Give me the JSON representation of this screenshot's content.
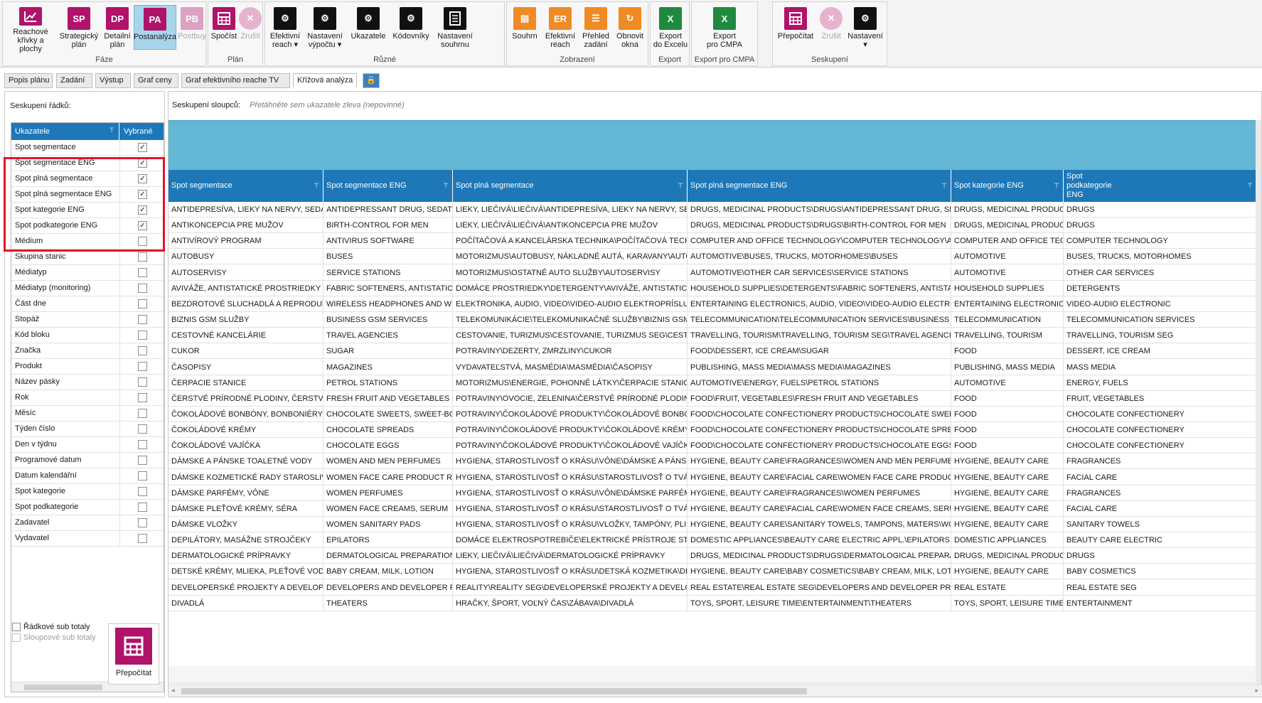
{
  "ribbon": {
    "groups": [
      {
        "title": "Fáze",
        "buttons": [
          {
            "label": "Reachové\nkřivky a plochy",
            "icon": "chart-icon",
            "abbr": "",
            "color": "#b0136a"
          },
          {
            "label": "Strategický\nplán",
            "icon": "sp-icon",
            "abbr": "SP",
            "color": "#b0136a"
          },
          {
            "label": "Detailní\nplán",
            "icon": "dp-icon",
            "abbr": "DP",
            "color": "#b0136a"
          },
          {
            "label": "Postanalýza",
            "icon": "pa-icon",
            "abbr": "PA",
            "color": "#b0136a",
            "active": true
          },
          {
            "label": "Postbuy",
            "icon": "pb-icon",
            "abbr": "PB",
            "color": "#d9a3c5",
            "disabled": true
          }
        ]
      },
      {
        "title": "Plán",
        "buttons": [
          {
            "label": "Spočíst",
            "icon": "calculator-icon",
            "color": "#b0136a"
          },
          {
            "label": "Zrušit",
            "icon": "cancel-icon",
            "color": "#e0a6c4",
            "disabled": true
          }
        ]
      },
      {
        "title": "Různé",
        "buttons": [
          {
            "label": "Efektivní\nreach ▾",
            "icon": "gear-icon",
            "color": "#111111"
          },
          {
            "label": "Nastavení\nvýpočtu ▾",
            "icon": "gear-icon",
            "color": "#111111"
          },
          {
            "label": "Ukazatele",
            "icon": "gear-icon",
            "color": "#111111"
          },
          {
            "label": "Kódovníky",
            "icon": "gear-icon",
            "color": "#111111"
          },
          {
            "label": "Nastavení\nsouhrnu",
            "icon": "document-icon",
            "color": "#111111"
          }
        ]
      },
      {
        "title": "Zobrazení",
        "buttons": [
          {
            "label": "Souhrn",
            "icon": "clipboard-icon",
            "color": "#f08a24"
          },
          {
            "label": "Efektivní\nreach",
            "icon": "er-icon",
            "abbr": "ER",
            "color": "#f08a24"
          },
          {
            "label": "Přehled\nzadání",
            "icon": "list-icon",
            "color": "#f08a24"
          },
          {
            "label": "Obnovit\nokna",
            "icon": "refresh-icon",
            "color": "#f08a24"
          }
        ]
      },
      {
        "title": "Export",
        "buttons": [
          {
            "label": "Export\ndo Excelu",
            "icon": "excel-icon",
            "abbr": "X",
            "color": "#1f8a3f"
          }
        ]
      },
      {
        "title": "Export pro CMPA",
        "buttons": [
          {
            "label": "Export\npro CMPA",
            "icon": "excel-icon",
            "abbr": "X",
            "color": "#1f8a3f"
          }
        ]
      },
      {
        "title": "Seskupení",
        "buttons": [
          {
            "label": "Přepočítat",
            "icon": "calculator-icon",
            "color": "#b0136a"
          },
          {
            "label": "Zrušit",
            "icon": "cancel-icon",
            "color": "#e0a6c4",
            "disabled": true
          },
          {
            "label": "Nastavení\n▾",
            "icon": "gear-icon",
            "color": "#111111"
          }
        ]
      }
    ]
  },
  "tabs": [
    "Popis plánu",
    "Zadání",
    "Výstup",
    "Graf ceny",
    "Graf efektivního reache TV",
    "Křížová analýza"
  ],
  "left": {
    "title": "Seskupení řádků:",
    "col1": "Ukazatele",
    "col2": "Vybrané",
    "rows": [
      {
        "label": "Spot segmentace",
        "checked": true
      },
      {
        "label": "Spot segmentace ENG",
        "checked": true
      },
      {
        "label": "Spot plná segmentace",
        "checked": true
      },
      {
        "label": "Spot plná segmentace ENG",
        "checked": true
      },
      {
        "label": "Spot kategorie ENG",
        "checked": true
      },
      {
        "label": "Spot podkategorie ENG",
        "checked": true
      },
      {
        "label": "Médium",
        "checked": false
      },
      {
        "label": "Skupina stanic",
        "checked": false
      },
      {
        "label": "Médiatyp",
        "checked": false
      },
      {
        "label": "Médiatyp (monitoring)",
        "checked": false
      },
      {
        "label": "Část dne",
        "checked": false
      },
      {
        "label": "Stopáž",
        "checked": false
      },
      {
        "label": "Kód bloku",
        "checked": false
      },
      {
        "label": "Značka",
        "checked": false
      },
      {
        "label": "Produkt",
        "checked": false
      },
      {
        "label": "Název pásky",
        "checked": false
      },
      {
        "label": "Rok",
        "checked": false
      },
      {
        "label": "Měsíc",
        "checked": false
      },
      {
        "label": "Týden číslo",
        "checked": false
      },
      {
        "label": "Den v týdnu",
        "checked": false
      },
      {
        "label": "Programové datum",
        "checked": false
      },
      {
        "label": "Datum kalendářní",
        "checked": false
      },
      {
        "label": "Spot kategorie",
        "checked": false
      },
      {
        "label": "Spot podkategorie",
        "checked": false
      },
      {
        "label": "Zadavatel",
        "checked": false
      },
      {
        "label": "Vydavatel",
        "checked": false
      }
    ],
    "row_subtotals": "Řádkové sub totaly",
    "col_subtotals": "Sloupcové sub totaly",
    "recalc": "Přepočítat"
  },
  "main": {
    "colgroup_label": "Seskupení sloupců:",
    "colgroup_placeholder": "Přetáhněte sem ukazatele zleva (nepovinné)",
    "headers": [
      "Spot segmentace",
      "Spot segmentace ENG",
      "Spot plná segmentace",
      "Spot plná segmentace ENG",
      "Spot kategorie ENG",
      "Spot\npodkategorie\nENG"
    ],
    "rows": [
      [
        "ANTIDEPRESÍVA, LIEKY NA NERVY, SEDATÍVA",
        "ANTIDEPRESSANT DRUG, SEDATIVES",
        "LIEKY, LIEČIVÁ\\LIEČIVÁ\\ANTIDEPRESÍVA, LIEKY NA NERVY, SEDATÍVA",
        "DRUGS, MEDICINAL PRODUCTS\\DRUGS\\ANTIDEPRESSANT DRUG, SEDATIVES",
        "DRUGS, MEDICINAL PRODUCTS",
        "DRUGS"
      ],
      [
        "ANTIKONCEPCIA PRE MUŽOV",
        "BIRTH-CONTROL FOR MEN",
        "LIEKY, LIEČIVÁ\\LIEČIVÁ\\ANTIKONCEPCIA PRE MUŽOV",
        "DRUGS, MEDICINAL PRODUCTS\\DRUGS\\BIRTH-CONTROL FOR MEN",
        "DRUGS, MEDICINAL PRODUCTS",
        "DRUGS"
      ],
      [
        "ANTIVÍROVÝ PROGRAM",
        "ANTIVIRUS SOFTWARE",
        "POČÍTAČOVÁ A KANCELÁRSKA TECHNIKA\\POČÍTAČOVÁ TECHNOLÓGIA",
        "COMPUTER AND OFFICE TECHNOLOGY\\COMPUTER TECHNOLOGY\\ANTIVIRUS",
        "COMPUTER AND OFFICE TECHNOLOGY",
        "COMPUTER TECHNOLOGY"
      ],
      [
        "AUTOBUSY",
        "BUSES",
        "MOTORIZMUS\\AUTOBUSY, NÁKLADNÉ AUTÁ, KARAVANY\\AUTOBUSY",
        "AUTOMOTIVE\\BUSES, TRUCKS, MOTORHOMES\\BUSES",
        "AUTOMOTIVE",
        "BUSES, TRUCKS, MOTORHOMES"
      ],
      [
        "AUTOSERVISY",
        "SERVICE STATIONS",
        "MOTORIZMUS\\OSTATNÉ AUTO SLUŽBY\\AUTOSERVISY",
        "AUTOMOTIVE\\OTHER CAR SERVICES\\SERVICE STATIONS",
        "AUTOMOTIVE",
        "OTHER CAR SERVICES"
      ],
      [
        "AVIVÁŽE, ANTISTATICKÉ PROSTRIEDKY",
        "FABRIC SOFTENERS, ANTISTATIC CONDITIONERS",
        "DOMÁCE PROSTRIEDKY\\DETERGENTY\\AVIVÁŽE, ANTISTATICKÉ PROSTRIEDKY",
        "HOUSEHOLD SUPPLIES\\DETERGENTS\\FABRIC SOFTENERS, ANTISTATIC CONDITIONERS",
        "HOUSEHOLD SUPPLIES",
        "DETERGENTS"
      ],
      [
        "BEZDROTOVÉ SLUCHADLÁ A REPRODUKTORY",
        "WIRELESS HEADPHONES AND WIRELESS SPEAKERS",
        "ELEKTRONIKA, AUDIO, VIDEO\\VIDEO-AUDIO ELEKTROPRÍSLUŠENSTVO",
        "ENTERTAINING ELECTRONICS, AUDIO, VIDEO\\VIDEO-AUDIO ELECTRONIC EQUIPMENT",
        "ENTERTAINING ELECTRONICS, AUDIO, VIDEO",
        "VIDEO-AUDIO ELECTRONIC"
      ],
      [
        "BIZNIS GSM SLUŽBY",
        "BUSINESS GSM SERVICES",
        "TELEKOMUNIKÁCIE\\TELEKOMUNIKAČNÉ SLUŽBY\\BIZNIS GSM SLUŽBY",
        "TELECOMMUNICATION\\TELECOMMUNICATION SERVICES\\BUSINESS GSM SERVICES",
        "TELECOMMUNICATION",
        "TELECOMMUNICATION SERVICES"
      ],
      [
        "CESTOVNÉ KANCELÁRIE",
        "TRAVEL AGENCIES",
        "CESTOVANIE, TURIZMUS\\CESTOVANIE, TURIZMUS SEG\\CESTOVNÉ KANCELÁRIE",
        "TRAVELLING, TOURISM\\TRAVELLING, TOURISM SEG\\TRAVEL AGENCIES",
        "TRAVELLING, TOURISM",
        "TRAVELLING, TOURISM SEG"
      ],
      [
        "CUKOR",
        "SUGAR",
        "POTRAVINY\\DEZERTY, ZMRZLINY\\CUKOR",
        "FOOD\\DESSERT, ICE CREAM\\SUGAR",
        "FOOD",
        "DESSERT, ICE CREAM"
      ],
      [
        "ČASOPISY",
        "MAGAZINES",
        "VYDAVATEĽSTVÁ, MASMÉDIA\\MASMÉDIA\\ČASOPISY",
        "PUBLISHING, MASS MEDIA\\MASS MEDIA\\MAGAZINES",
        "PUBLISHING, MASS MEDIA",
        "MASS MEDIA"
      ],
      [
        "ČERPACIE STANICE",
        "PETROL STATIONS",
        "MOTORIZMUS\\ENERGIE, POHONNÉ LÁTKY\\ČERPACIE STANICE",
        "AUTOMOTIVE\\ENERGY, FUELS\\PETROL STATIONS",
        "AUTOMOTIVE",
        "ENERGY, FUELS"
      ],
      [
        "ČERSTVÉ PRÍRODNÉ PLODINY, ČERSTVÉ OVOCIE",
        "FRESH FRUIT AND VEGETABLES",
        "POTRAVINY\\OVOCIE, ZELENINA\\ČERSTVÉ PRÍRODNÉ PLODINY, ČERSTVÉ OVOCIE",
        "FOOD\\FRUIT, VEGETABLES\\FRESH FRUIT AND VEGETABLES",
        "FOOD",
        "FRUIT, VEGETABLES"
      ],
      [
        "ČOKOLÁDOVÉ BONBÓNY, BONBONIÉRY",
        "CHOCOLATE SWEETS, SWEET-BOXES",
        "POTRAVINY\\ČOKOLÁDOVÉ PRODUKTY\\ČOKOLÁDOVÉ BONBÓNY, BONBONIÉRY",
        "FOOD\\CHOCOLATE CONFECTIONERY PRODUCTS\\CHOCOLATE SWEETS, SWEET-BOXES",
        "FOOD",
        "CHOCOLATE CONFECTIONERY"
      ],
      [
        "ČOKOLÁDOVÉ KRÉMY",
        "CHOCOLATE SPREADS",
        "POTRAVINY\\ČOKOLÁDOVÉ PRODUKTY\\ČOKOLÁDOVÉ KRÉMY",
        "FOOD\\CHOCOLATE CONFECTIONERY PRODUCTS\\CHOCOLATE SPREADS",
        "FOOD",
        "CHOCOLATE CONFECTIONERY"
      ],
      [
        "ČOKOLÁDOVÉ VAJÍČKA",
        "CHOCOLATE EGGS",
        "POTRAVINY\\ČOKOLÁDOVÉ PRODUKTY\\ČOKOLÁDOVÉ VAJÍČKA",
        "FOOD\\CHOCOLATE CONFECTIONERY PRODUCTS\\CHOCOLATE EGGS",
        "FOOD",
        "CHOCOLATE CONFECTIONERY"
      ],
      [
        "DÁMSKE A PÁNSKE TOALETNÉ VODY",
        "WOMEN AND MEN PERFUMES",
        "HYGIENA, STAROSTLIVOSŤ O KRÁSU\\VÔNE\\DÁMSKE A PÁNSKE TOALETNÉ VODY",
        "HYGIENE, BEAUTY CARE\\FRAGRANCES\\WOMEN AND MEN PERFUMES",
        "HYGIENE, BEAUTY CARE",
        "FRAGRANCES"
      ],
      [
        "DÁMSKE KOZMETICKÉ RADY STAROSLIVOSTI O PLEŤ",
        "WOMEN FACE CARE PRODUCT RANGE",
        "HYGIENA, STAROSTLIVOSŤ O KRÁSU\\STAROSTLIVOSŤ O TVÁR\\DÁMSKE",
        "HYGIENE, BEAUTY CARE\\FACIAL CARE\\WOMEN FACE CARE PRODUCT RANGE",
        "HYGIENE, BEAUTY CARE",
        "FACIAL CARE"
      ],
      [
        "DÁMSKE PARFÉMY, VÔNE",
        "WOMEN PERFUMES",
        "HYGIENA, STAROSTLIVOSŤ O KRÁSU\\VÔNE\\DÁMSKE PARFÉMY, VÔNE",
        "HYGIENE, BEAUTY CARE\\FRAGRANCES\\WOMEN PERFUMES",
        "HYGIENE, BEAUTY CARE",
        "FRAGRANCES"
      ],
      [
        "DÁMSKE PLEŤOVÉ KRÉMY, SÉRA",
        "WOMEN FACE CREAMS, SERUM",
        "HYGIENA, STAROSTLIVOSŤ O KRÁSU\\STAROSTLIVOSŤ O TVÁR\\DÁMSKE",
        "HYGIENE, BEAUTY CARE\\FACIAL CARE\\WOMEN FACE CREAMS, SERUM",
        "HYGIENE, BEAUTY CARE",
        "FACIAL CARE"
      ],
      [
        "DÁMSKE VLOŽKY",
        "WOMEN SANITARY PADS",
        "HYGIENA, STAROSTLIVOSŤ O KRÁSU\\VLOŽKY, TAMPÓNY, PLIENKY\\DÁMSKE",
        "HYGIENE, BEAUTY CARE\\SANITARY TOWELS, TAMPONS, MATERS\\WOMEN SANITARY PADS",
        "HYGIENE, BEAUTY CARE",
        "SANITARY TOWELS"
      ],
      [
        "DEPILÁTORY, MASÁŽNE STROJČEKY",
        "EPILATORS",
        "DOMÁCE ELEKTROSPOTREBIČE\\ELEKTRICKÉ PRÍSTROJE STAROSTLIVOSTI",
        "DOMESTIC APPLIANCES\\BEAUTY CARE ELECTRIC APPL.\\EPILATORS",
        "DOMESTIC APPLIANCES",
        "BEAUTY CARE ELECTRIC"
      ],
      [
        "DERMATOLOGICKÉ PRÍPRAVKY",
        "DERMATOLOGICAL PREPARATIONS",
        "LIEKY, LIEČIVÁ\\LIEČIVÁ\\DERMATOLOGICKÉ PRÍPRAVKY",
        "DRUGS, MEDICINAL PRODUCTS\\DRUGS\\DERMATOLOGICAL PREPARATIONS",
        "DRUGS, MEDICINAL PRODUCTS",
        "DRUGS"
      ],
      [
        "DETSKÉ KRÉMY, MLIEKA, PLEŤOVÉ VODY",
        "BABY CREAM, MILK, LOTION",
        "HYGIENA, STAROSTLIVOSŤ O KRÁSU\\DETSKÁ KOZMETIKA\\DETSKÉ KRÉMY",
        "HYGIENE, BEAUTY CARE\\BABY COSMETICS\\BABY CREAM, MILK, LOTION",
        "HYGIENE, BEAUTY CARE",
        "BABY COSMETICS"
      ],
      [
        "DEVELOPERSKÉ PROJEKTY A DEVELOPERI",
        "DEVELOPERS AND DEVELOPER PROJECTS",
        "REALITY\\REALITY SEG\\DEVELOPERSKÉ PROJEKTY A DEVELOPERI",
        "REAL ESTATE\\REAL ESTATE SEG\\DEVELOPERS AND DEVELOPER PROJECTS",
        "REAL ESTATE",
        "REAL ESTATE SEG"
      ],
      [
        "DIVADLÁ",
        "THEATERS",
        "HRAČKY, ŠPORT, VOĽNÝ ČAS\\ZÁBAVA\\DIVADLÁ",
        "TOYS, SPORT, LEISURE TIME\\ENTERTAINMENT\\THEATERS",
        "TOYS, SPORT, LEISURE TIME",
        "ENTERTAINMENT"
      ]
    ]
  }
}
